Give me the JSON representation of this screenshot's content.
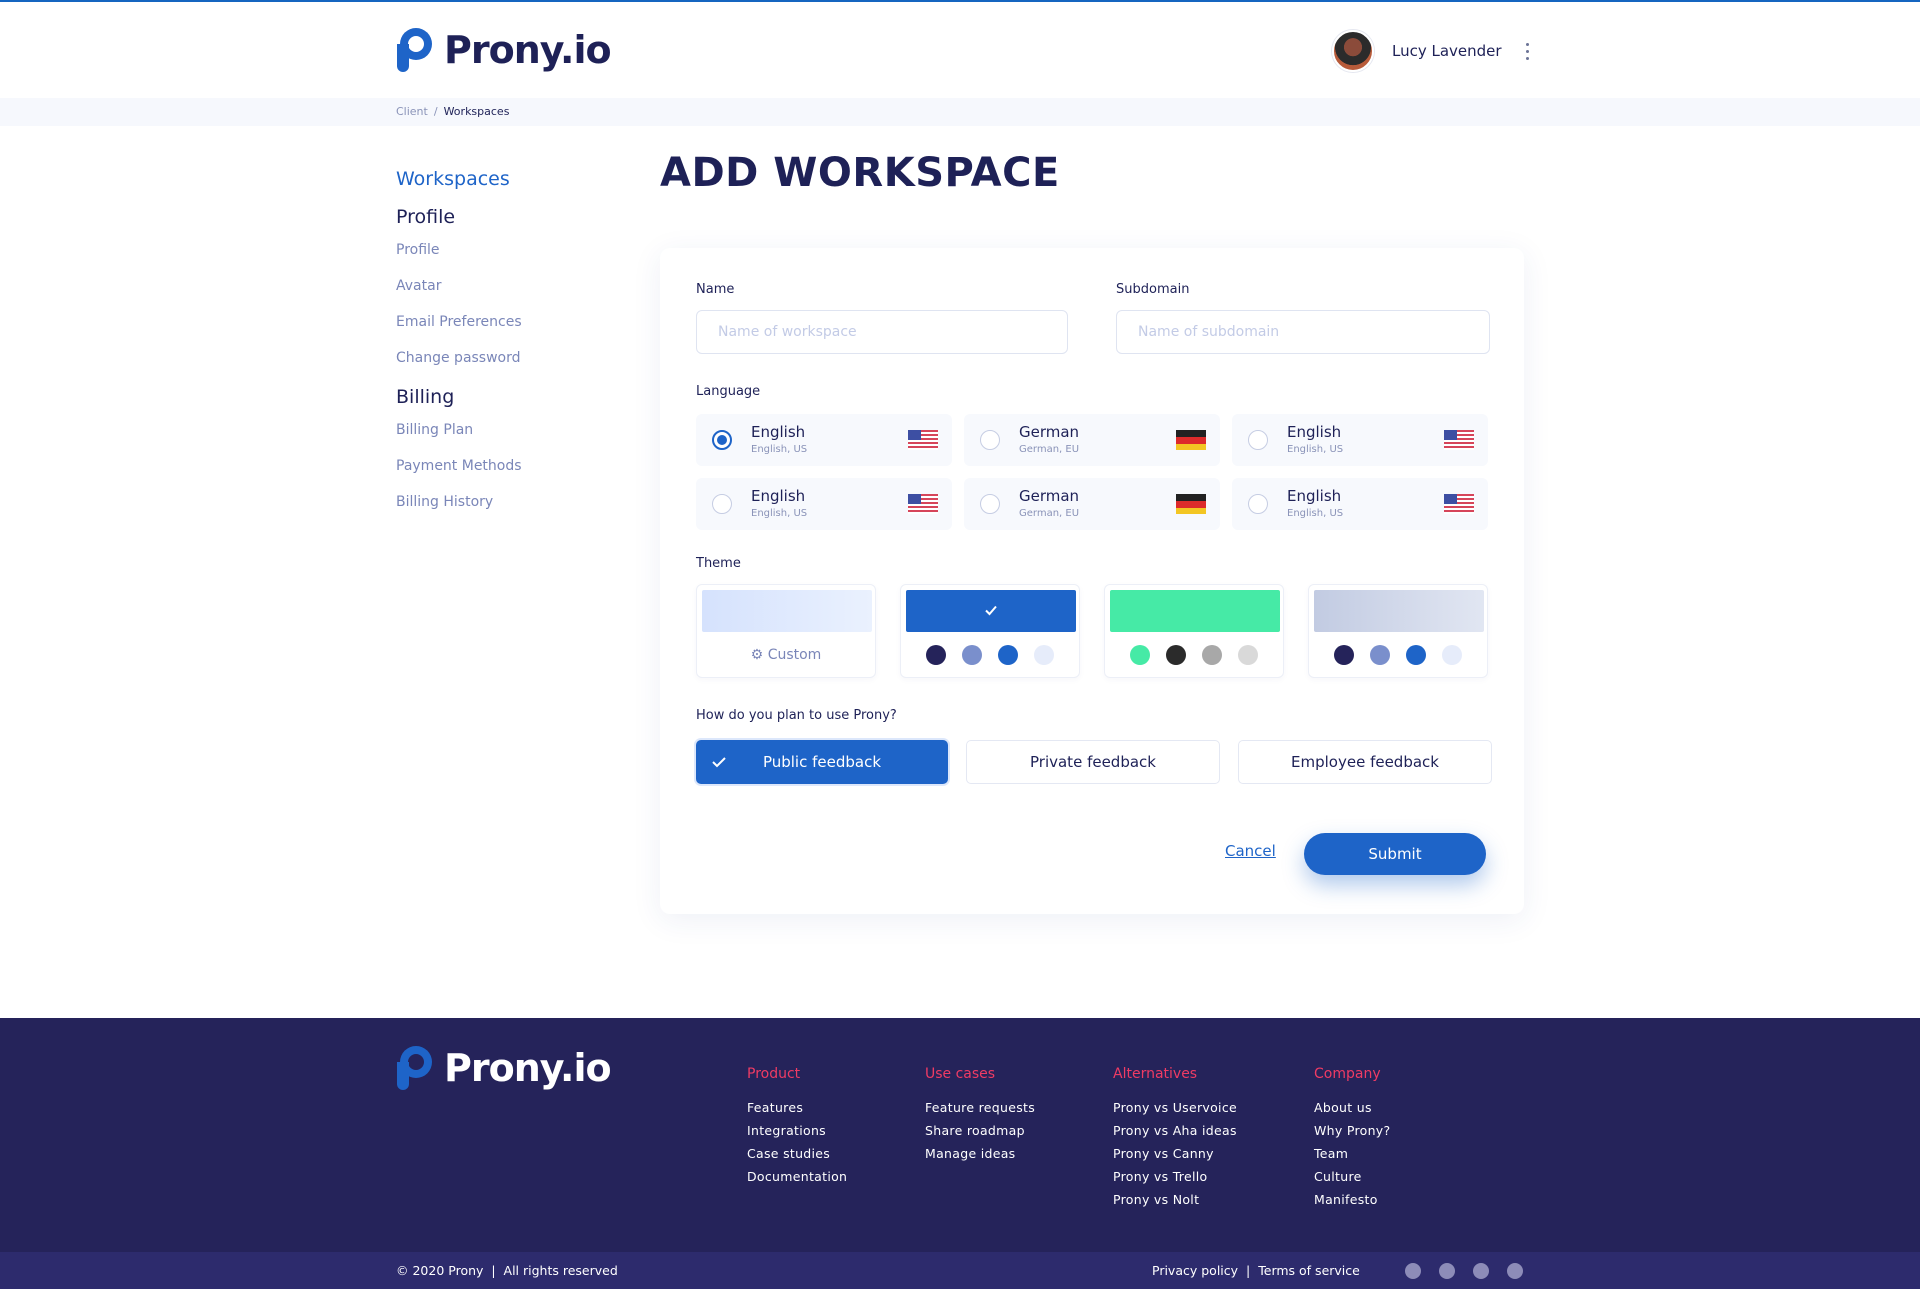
{
  "header": {
    "logo_text": "Prony.io",
    "user_name": "Lucy Lavender"
  },
  "breadcrumb": {
    "items": [
      "Client",
      "Workspaces"
    ],
    "separator": "/"
  },
  "sidebar": {
    "primary": "Workspaces",
    "sections": [
      {
        "title": "Profile",
        "links": [
          "Profile",
          "Avatar",
          "Email Preferences",
          "Change password"
        ]
      },
      {
        "title": "Billing",
        "links": [
          "Billing Plan",
          "Payment Methods",
          "Billing History"
        ]
      }
    ]
  },
  "page": {
    "title": "ADD WORKSPACE"
  },
  "form": {
    "name_label": "Name",
    "name_placeholder": "Name of workspace",
    "subdomain_label": "Subdomain",
    "subdomain_placeholder": "Name of subdomain",
    "language_label": "Language",
    "languages": [
      {
        "name": "English",
        "sub": "English, US",
        "flag": "us-flag-icon",
        "selected": true
      },
      {
        "name": "German",
        "sub": "German, EU",
        "flag": "de-flag-icon",
        "selected": false
      },
      {
        "name": "English",
        "sub": "English, US",
        "flag": "us-flag-icon",
        "selected": false
      },
      {
        "name": "English",
        "sub": "English, US",
        "flag": "us-flag-icon",
        "selected": false
      },
      {
        "name": "German",
        "sub": "German, EU",
        "flag": "de-flag-icon",
        "selected": false
      },
      {
        "name": "English",
        "sub": "English, US",
        "flag": "us-flag-icon",
        "selected": false
      }
    ],
    "theme_label": "Theme",
    "themes": [
      {
        "type": "custom",
        "label": "Custom",
        "icon": "gear-icon",
        "swatch": "#dbe6fd"
      },
      {
        "type": "preset",
        "swatch": "#1e64c8",
        "selected": true,
        "dots": [
          "#25235a",
          "#7a8fcc",
          "#1e64c8",
          "#e6ecfa"
        ]
      },
      {
        "type": "preset",
        "swatch": "#46eaa6",
        "selected": false,
        "dots": [
          "#46eaa6",
          "#2b2b2b",
          "#a8a8a8",
          "#d9d9d9"
        ]
      },
      {
        "type": "preset",
        "swatch": "#cbd3e8",
        "selected": false,
        "dots": [
          "#25235a",
          "#7a8fcc",
          "#1e64c8",
          "#e6ecfa"
        ]
      }
    ],
    "usage_label": "How do you plan to use Prony?",
    "usage_options": [
      {
        "label": "Public feedback",
        "selected": true
      },
      {
        "label": "Private feedback",
        "selected": false
      },
      {
        "label": "Employee feedback",
        "selected": false
      }
    ],
    "cancel_label": "Cancel",
    "submit_label": "Submit"
  },
  "footer": {
    "logo_text": "Prony.io",
    "columns": [
      {
        "title": "Product",
        "links": [
          "Features",
          "Integrations",
          "Case studies",
          "Documentation"
        ]
      },
      {
        "title": "Use cases",
        "links": [
          "Feature requests",
          "Share roadmap",
          "Manage ideas"
        ]
      },
      {
        "title": "Alternatives",
        "links": [
          "Prony vs Uservoice",
          "Prony vs Aha ideas",
          "Prony vs Canny",
          "Prony vs Trello",
          "Prony vs Nolt"
        ]
      },
      {
        "title": "Company",
        "links": [
          "About us",
          "Why Prony?",
          "Team",
          "Culture",
          "Manifesto"
        ]
      }
    ],
    "copyright": "© 2020 Prony  |  All rights reserved",
    "privacy": "Privacy policy",
    "legal_sep": "|",
    "terms": "Terms of service",
    "socials": [
      "facebook-icon",
      "instagram-icon",
      "twitter-icon",
      "youtube-icon"
    ]
  },
  "colors": {
    "accent": "#1e64c8",
    "navy": "#1e2157",
    "footer_bg": "#25235a",
    "footer_heading": "#ef3b64"
  }
}
